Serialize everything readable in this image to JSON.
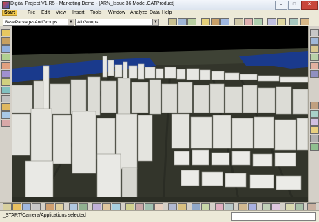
{
  "window": {
    "title": "Digital Project V1,R5  - Marketing Demo - [ARN_Issue 36 Model.CATProduct]",
    "controls": [
      "minimize-icon",
      "maximize-icon",
      "close-icon"
    ]
  },
  "menu": {
    "items": [
      "Start",
      "File",
      "Edit",
      "View",
      "Insert",
      "Tools",
      "Window",
      "Analyze",
      "Data",
      "Help"
    ]
  },
  "toolbar": {
    "package_combo": "BasePackagesAndGroups",
    "group_combo": "All Groups"
  },
  "viewport": {
    "scene": "3d-city-model",
    "colors": {
      "sky": "#000000",
      "water": "#1a3a8c",
      "ground": "#33352b",
      "building": "#e7e7e3"
    }
  },
  "status": {
    "text": "_START/Camera/Applications selected",
    "command_input": ""
  },
  "colors": {
    "accent_start": "#f2c94c",
    "title_close": "#c8463c"
  }
}
